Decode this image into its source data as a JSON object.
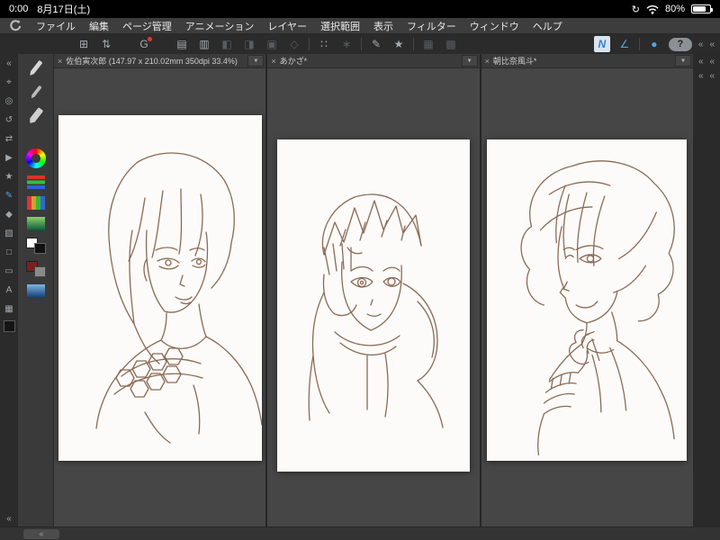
{
  "status_bar": {
    "time": "0:00",
    "date": "8月17日(土)",
    "battery_percent": "80%"
  },
  "menu_bar": {
    "items": [
      "ファイル",
      "編集",
      "ページ管理",
      "アニメーション",
      "レイヤー",
      "選択範囲",
      "表示",
      "フィルター",
      "ウィンドウ",
      "ヘルプ"
    ]
  },
  "icons": {
    "collapse": "«",
    "close": "×",
    "dropdown": "▼",
    "rotation_lock": "↻"
  },
  "toolbar": {
    "buttons": [
      {
        "name": "layout-grid",
        "glyph": "⊞"
      },
      {
        "name": "import-export",
        "glyph": "⇅"
      },
      {
        "name": "clip-studio",
        "glyph": "G"
      },
      {
        "name": "new-page",
        "glyph": "▤"
      },
      {
        "name": "duplicate-page",
        "glyph": "▥"
      },
      {
        "name": "prev-page",
        "glyph": "◧"
      },
      {
        "name": "next-page",
        "glyph": "◨"
      },
      {
        "name": "stop",
        "glyph": "▣"
      },
      {
        "name": "keyframe",
        "glyph": "◇"
      },
      {
        "name": "snap-dots",
        "glyph": "∷"
      },
      {
        "name": "transform",
        "glyph": "∗"
      },
      {
        "name": "paint",
        "glyph": "✎"
      },
      {
        "name": "auto-select",
        "glyph": "★"
      },
      {
        "name": "grid-a",
        "glyph": "▦"
      },
      {
        "name": "grid-b",
        "glyph": "▩"
      },
      {
        "name": "ruler-snap",
        "glyph": "N"
      },
      {
        "name": "angle-snap",
        "glyph": "∠"
      },
      {
        "name": "stylus",
        "glyph": "●"
      }
    ],
    "help_label": "?"
  },
  "tool_column": {
    "items": [
      {
        "name": "collapse-top",
        "glyph": "«"
      },
      {
        "name": "select",
        "glyph": "⌖"
      },
      {
        "name": "zoom",
        "glyph": "◎"
      },
      {
        "name": "rotate-view",
        "glyph": "↺"
      },
      {
        "name": "flip-view",
        "glyph": "⇄"
      },
      {
        "name": "cursor",
        "glyph": "▶"
      },
      {
        "name": "magic-wand",
        "glyph": "★"
      },
      {
        "name": "pen",
        "glyph": "✎",
        "selected": true
      },
      {
        "name": "fill",
        "glyph": "◆"
      },
      {
        "name": "gradient",
        "glyph": "▨"
      },
      {
        "name": "selection-rect",
        "glyph": "□"
      },
      {
        "name": "frame",
        "glyph": "▭"
      },
      {
        "name": "text",
        "glyph": "A"
      },
      {
        "name": "pattern",
        "glyph": "▦"
      },
      {
        "name": "swatch-black",
        "glyph": "■"
      },
      {
        "name": "collapse-bottom",
        "glyph": "«"
      }
    ]
  },
  "subtool_column": {
    "items": [
      {
        "name": "pencil-subtool"
      },
      {
        "name": "eyedropper-subtool"
      },
      {
        "name": "brush-subtool"
      },
      {
        "name": "color-wheel"
      },
      {
        "name": "color-sliders"
      },
      {
        "name": "color-set"
      },
      {
        "name": "gradient-green-swatch"
      },
      {
        "name": "foreground-background-colors"
      },
      {
        "name": "approximate-color-swatches"
      },
      {
        "name": "gradient-blue-swatch"
      }
    ]
  },
  "documents": [
    {
      "title": "佐伯寅次郎 (147.97 x 210.02mm 350dpi 33.4%)"
    },
    {
      "title": "あかざ*"
    },
    {
      "title": "朝比奈風斗*"
    }
  ],
  "colors": {
    "accent_blue": "#4fa3e3",
    "sketch_line": "#8a6a55",
    "canvas_white": "#fcfbf9"
  }
}
